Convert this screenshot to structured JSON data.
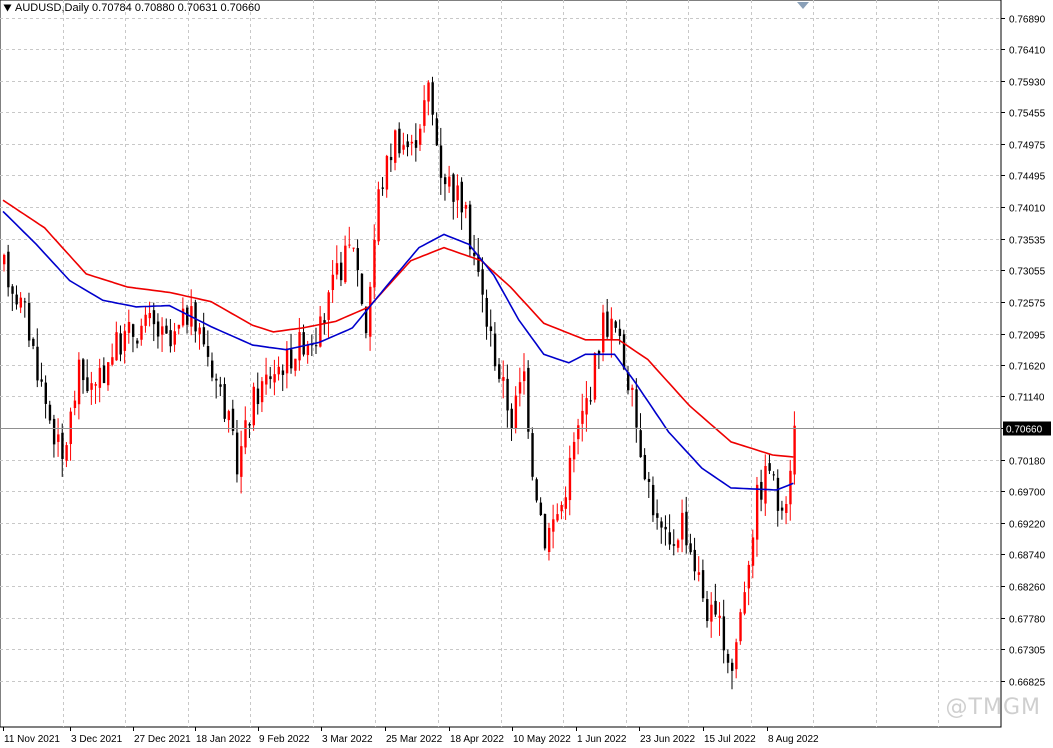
{
  "header": {
    "symbol": "AUDUSD",
    "timeframe": "Daily",
    "ohlc": "0.70784 0.70880 0.70631 0.70660"
  },
  "watermark": "@TMGM",
  "current_price_label": "0.70660",
  "colors": {
    "bull": "#ff0000",
    "bear": "#000000",
    "ma_fast": "#0000cc",
    "ma_slow": "#ee0000",
    "grid": "#c8c8c8",
    "price_line": "#909090"
  },
  "chart_data": {
    "type": "candlestick",
    "title": "AUDUSD,Daily",
    "grid": true,
    "ylim": [
      0.6612,
      0.7716
    ],
    "y_ticks": [
      "0.76890",
      "0.76410",
      "0.75930",
      "0.75455",
      "0.74975",
      "0.74495",
      "0.74010",
      "0.73535",
      "0.73055",
      "0.72575",
      "0.72095",
      "0.71620",
      "0.71140",
      "0.70660",
      "0.70180",
      "0.69700",
      "0.69220",
      "0.68740",
      "0.68260",
      "0.67780",
      "0.67305",
      "0.66825"
    ],
    "x_labels": [
      "11 Nov 2021",
      "3 Dec 2021",
      "27 Dec 2021",
      "18 Jan 2022",
      "9 Feb 2022",
      "3 Mar 2022",
      "25 Mar 2022",
      "18 Apr 2022",
      "10 May 2022",
      "1 Jun 2022",
      "23 Jun 2022",
      "15 Jul 2022",
      "8 Aug 2022"
    ],
    "current_price": 0.7066,
    "series": [
      {
        "name": "",
        "kind": "ma",
        "color": "red",
        "anchors": [
          [
            0,
            0.7412
          ],
          [
            10,
            0.737
          ],
          [
            20,
            0.73
          ],
          [
            30,
            0.728
          ],
          [
            40,
            0.7272
          ],
          [
            50,
            0.7258
          ],
          [
            60,
            0.7222
          ],
          [
            65,
            0.7212
          ],
          [
            72,
            0.7218
          ],
          [
            80,
            0.7228
          ],
          [
            88,
            0.725
          ],
          [
            98,
            0.732
          ],
          [
            106,
            0.734
          ],
          [
            115,
            0.732
          ],
          [
            122,
            0.728
          ],
          [
            130,
            0.7225
          ],
          [
            140,
            0.72
          ],
          [
            148,
            0.72
          ],
          [
            155,
            0.717
          ],
          [
            165,
            0.71
          ],
          [
            175,
            0.7045
          ],
          [
            185,
            0.7025
          ],
          [
            190,
            0.7022
          ]
        ]
      },
      {
        "name": "",
        "kind": "ma",
        "color": "blue",
        "anchors": [
          [
            0,
            0.7395
          ],
          [
            8,
            0.7345
          ],
          [
            16,
            0.729
          ],
          [
            24,
            0.726
          ],
          [
            32,
            0.725
          ],
          [
            40,
            0.7252
          ],
          [
            50,
            0.722
          ],
          [
            60,
            0.7192
          ],
          [
            68,
            0.7185
          ],
          [
            76,
            0.7196
          ],
          [
            84,
            0.7218
          ],
          [
            92,
            0.728
          ],
          [
            100,
            0.734
          ],
          [
            106,
            0.736
          ],
          [
            112,
            0.7345
          ],
          [
            118,
            0.7298
          ],
          [
            124,
            0.723
          ],
          [
            130,
            0.7178
          ],
          [
            136,
            0.7165
          ],
          [
            140,
            0.7178
          ],
          [
            147,
            0.7178
          ],
          [
            152,
            0.7135
          ],
          [
            160,
            0.706
          ],
          [
            168,
            0.7005
          ],
          [
            175,
            0.6975
          ],
          [
            182,
            0.6973
          ],
          [
            186,
            0.6972
          ],
          [
            190,
            0.6982
          ]
        ]
      }
    ],
    "anchors": [
      [
        0,
        0.731
      ],
      [
        5,
        0.724
      ],
      [
        10,
        0.7105
      ],
      [
        14,
        0.7015
      ],
      [
        18,
        0.715
      ],
      [
        22,
        0.712
      ],
      [
        26,
        0.7185
      ],
      [
        30,
        0.721
      ],
      [
        35,
        0.7225
      ],
      [
        40,
        0.719
      ],
      [
        44,
        0.724
      ],
      [
        48,
        0.72
      ],
      [
        53,
        0.71
      ],
      [
        56,
        0.701
      ],
      [
        60,
        0.711
      ],
      [
        64,
        0.715
      ],
      [
        68,
        0.717
      ],
      [
        72,
        0.72
      ],
      [
        76,
        0.7215
      ],
      [
        80,
        0.73
      ],
      [
        84,
        0.735
      ],
      [
        87,
        0.722
      ],
      [
        90,
        0.742
      ],
      [
        94,
        0.751
      ],
      [
        98,
        0.749
      ],
      [
        102,
        0.758
      ],
      [
        105,
        0.746
      ],
      [
        110,
        0.741
      ],
      [
        113,
        0.733
      ],
      [
        116,
        0.723
      ],
      [
        119,
        0.715
      ],
      [
        122,
        0.708
      ],
      [
        125,
        0.715
      ],
      [
        127,
        0.701
      ],
      [
        130,
        0.69
      ],
      [
        134,
        0.695
      ],
      [
        137,
        0.704
      ],
      [
        141,
        0.713
      ],
      [
        144,
        0.723
      ],
      [
        147,
        0.7215
      ],
      [
        150,
        0.714
      ],
      [
        153,
        0.704
      ],
      [
        157,
        0.692
      ],
      [
        160,
        0.688
      ],
      [
        163,
        0.693
      ],
      [
        166,
        0.686
      ],
      [
        169,
        0.679
      ],
      [
        172,
        0.676
      ],
      [
        175,
        0.67
      ],
      [
        178,
        0.683
      ],
      [
        181,
        0.696
      ],
      [
        184,
        0.701
      ],
      [
        187,
        0.692
      ],
      [
        190,
        0.7066
      ]
    ],
    "visible_candles": 191
  }
}
